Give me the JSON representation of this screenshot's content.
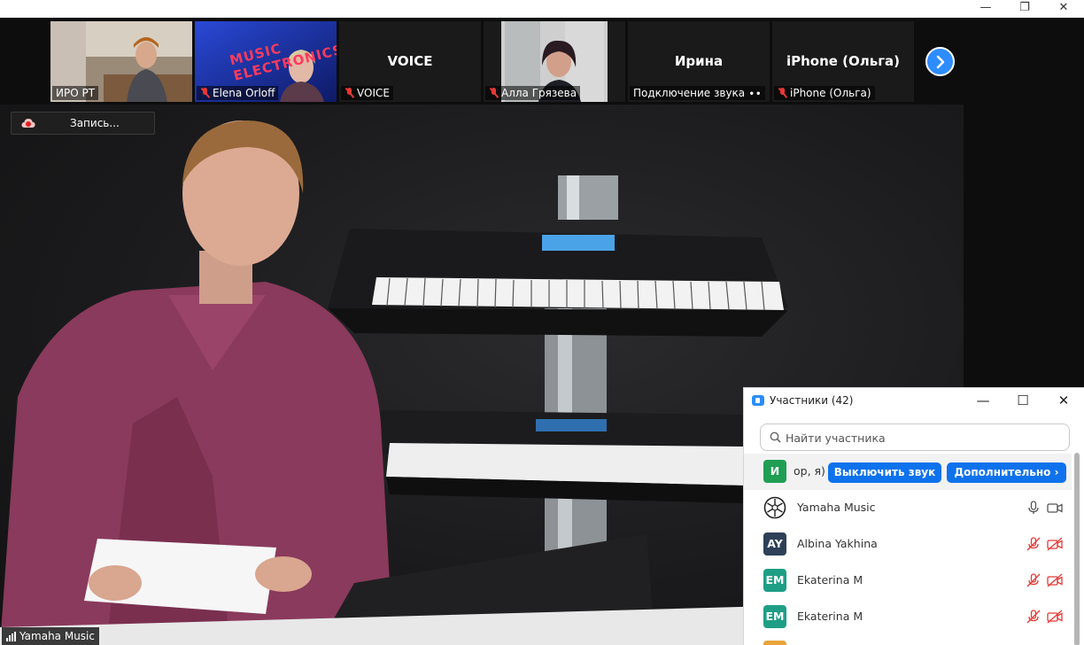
{
  "window": {
    "minimize_glyph": "—",
    "restore_glyph": "❐",
    "close_glyph": "✕"
  },
  "thumbnails": [
    {
      "label": "ИРО РТ",
      "muted": false,
      "has_video": true
    },
    {
      "label": "Elena Orloff",
      "muted": true,
      "has_video": true,
      "poster_text": "MUSIC ELECTRONICS"
    },
    {
      "label": "VOICE",
      "muted": true,
      "has_video": false,
      "big_name": "VOICE"
    },
    {
      "label": "Алла Грязева",
      "muted": true,
      "has_video": true
    },
    {
      "label": "Подключение звука ∙∙",
      "muted": false,
      "has_video": false,
      "big_name": "Ирина"
    },
    {
      "label": "iPhone (Ольга)",
      "muted": true,
      "has_video": false,
      "big_name": "iPhone (Ольга)"
    }
  ],
  "next_icon": "chevron-right-icon",
  "recording": {
    "label": "Запись..."
  },
  "speaker": {
    "label": "Yamaha Music"
  },
  "participants_panel": {
    "title": "Участники (42)",
    "search_placeholder": "Найти участника",
    "self_row": {
      "initial": "И",
      "truncated_name": "ор, я)",
      "mute_button": "Выключить звук",
      "more_button": "Дополнительно ›"
    },
    "rows": [
      {
        "name": "Yamaha Music",
        "avatar_text": "",
        "avatar_color": "#ffffff",
        "mic": "on",
        "video": "on"
      },
      {
        "name": "Albina Yakhina",
        "avatar_text": "AY",
        "avatar_color": "#2e4057",
        "mic": "off",
        "video": "off"
      },
      {
        "name": "Ekaterina M",
        "avatar_text": "EM",
        "avatar_color": "#1f9e86",
        "mic": "off",
        "video": "off"
      },
      {
        "name": "Ekaterina M",
        "avatar_text": "EM",
        "avatar_color": "#1f9e86",
        "mic": "off",
        "video": "off"
      }
    ]
  },
  "colors": {
    "accent": "#2d8cff",
    "button": "#0e72ed",
    "muted_red": "#e53935",
    "self_avatar": "#1f9e54"
  }
}
